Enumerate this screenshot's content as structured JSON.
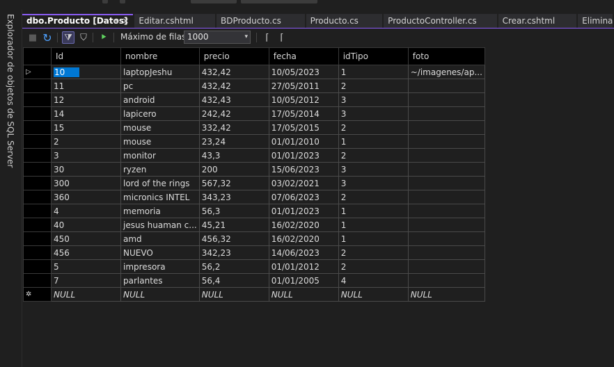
{
  "side_panel": {
    "label": "Explorador de objetos de SQL Server"
  },
  "tabs": [
    {
      "label": "dbo.Producto [Datos]",
      "active": true,
      "pin": "⊕",
      "close": "×"
    },
    {
      "label": "Editar.cshtml"
    },
    {
      "label": "BDProducto.cs"
    },
    {
      "label": "Producto.cs"
    },
    {
      "label": "ProductoController.cs"
    },
    {
      "label": "Crear.cshtml"
    },
    {
      "label": "Eliminar"
    }
  ],
  "toolbar": {
    "stop_icon": "■",
    "refresh_icon": "↻",
    "filter_active_icon": "⧩",
    "filter_icon": "⛉",
    "execute_icon": "⯈",
    "max_rows_label": "Máximo de filas:",
    "max_rows_value": "1000",
    "dropdown_icon": "▾",
    "script_icon": "⌈",
    "script_file_icon": "⌈"
  },
  "grid": {
    "columns": [
      "Id",
      "nombre",
      "precio",
      "fecha",
      "idTipo",
      "foto"
    ],
    "current_row_marker": "▷",
    "new_row_marker": "✲",
    "rows": [
      [
        "10",
        "laptopJeshu",
        "432,42",
        "10/05/2023",
        "1",
        "~/imagenes/ap..."
      ],
      [
        "11",
        "pc",
        "432,42",
        "27/05/2011",
        "2",
        ""
      ],
      [
        "12",
        "android",
        "432,43",
        "10/05/2012",
        "3",
        ""
      ],
      [
        "14",
        "lapicero",
        "242,42",
        "17/05/2014",
        "3",
        ""
      ],
      [
        "15",
        "mouse",
        "332,42",
        "17/05/2015",
        "2",
        ""
      ],
      [
        "2",
        "mouse",
        "23,24",
        "01/01/2010",
        "1",
        ""
      ],
      [
        "3",
        "monitor",
        "43,3",
        "01/01/2023",
        "2",
        ""
      ],
      [
        "30",
        "ryzen",
        "200",
        "15/06/2023",
        "3",
        ""
      ],
      [
        "300",
        "lord of the rings",
        "567,32",
        "03/02/2021",
        "3",
        ""
      ],
      [
        "360",
        "micronics INTEL",
        "343,23",
        "07/06/2023",
        "2",
        ""
      ],
      [
        "4",
        "memoria",
        "56,3",
        "01/01/2023",
        "1",
        ""
      ],
      [
        "40",
        "jesus huaman c...",
        "45,21",
        "16/02/2020",
        "1",
        ""
      ],
      [
        "450",
        "amd",
        "456,32",
        "16/02/2020",
        "1",
        ""
      ],
      [
        "456",
        "NUEVO",
        "342,23",
        "14/06/2023",
        "2",
        ""
      ],
      [
        "5",
        "impresora",
        "56,2",
        "01/01/2012",
        "2",
        ""
      ],
      [
        "7",
        "parlantes",
        "56,4",
        "01/01/2005",
        "4",
        ""
      ]
    ],
    "null_row": [
      "NULL",
      "NULL",
      "NULL",
      "NULL",
      "NULL",
      "NULL"
    ]
  }
}
